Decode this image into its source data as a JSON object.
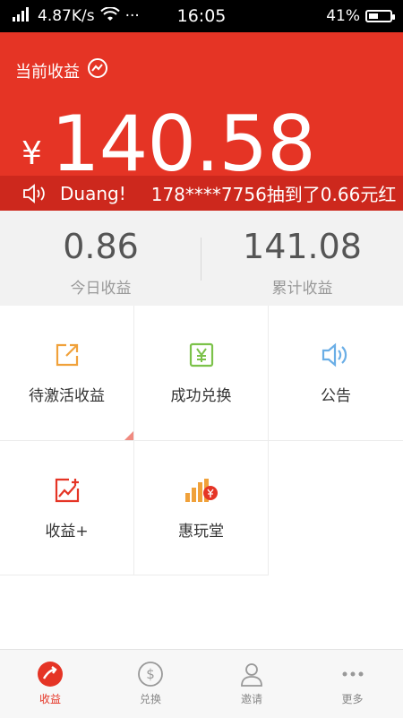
{
  "status_bar": {
    "speed": "4.87K/s",
    "more": "···",
    "time": "16:05",
    "battery": "41%"
  },
  "header": {
    "title": "当前收益",
    "currency": "¥",
    "amount": "140.58",
    "ticker_prefix": "Duang!",
    "ticker_text": "178****7756抽到了0.66元红"
  },
  "summary": {
    "today_value": "0.86",
    "today_label": "今日收益",
    "total_value": "141.08",
    "total_label": "累计收益"
  },
  "grid": {
    "pending_label": "待激活收益",
    "exchange_label": "成功兑换",
    "notice_label": "公告",
    "plus_label": "收益+",
    "fun_label": "惠玩堂"
  },
  "tabs": {
    "earnings": "收益",
    "exchange": "兑换",
    "invite": "邀请",
    "more": "更多"
  },
  "colors": {
    "brand_red": "#e53425",
    "orange": "#f0a13a",
    "green": "#7cc24a",
    "blue": "#6aaee6"
  }
}
